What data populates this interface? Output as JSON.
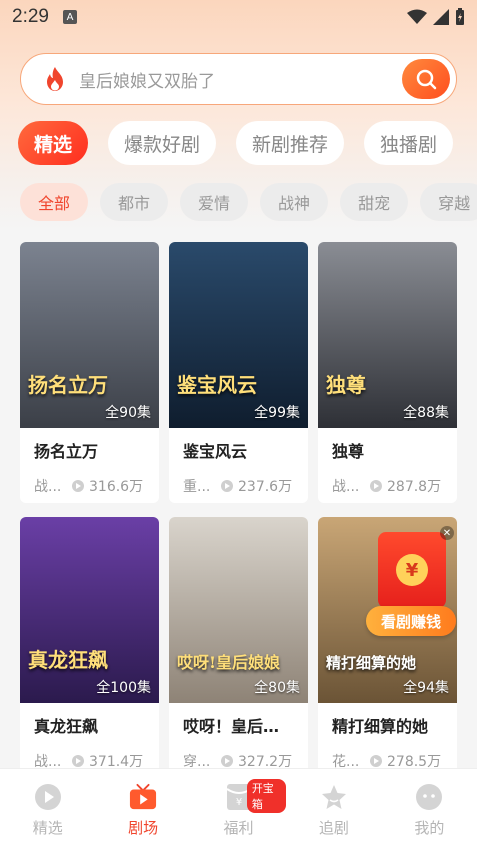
{
  "status_bar": {
    "time": "2:29",
    "notification_icon": "A"
  },
  "search": {
    "placeholder": "皇后娘娘又双胎了"
  },
  "main_tabs": [
    {
      "label": "精选",
      "active": true
    },
    {
      "label": "爆款好剧",
      "active": false
    },
    {
      "label": "新剧推荐",
      "active": false
    },
    {
      "label": "独播剧",
      "active": false
    }
  ],
  "sub_tabs": [
    {
      "label": "全部",
      "active": true
    },
    {
      "label": "都市",
      "active": false
    },
    {
      "label": "爱情",
      "active": false
    },
    {
      "label": "战神",
      "active": false
    },
    {
      "label": "甜宠",
      "active": false
    },
    {
      "label": "穿越",
      "active": false
    }
  ],
  "dramas": [
    {
      "title": "扬名立万",
      "episodes": "全90集",
      "genre": "战...",
      "views": "316.6万",
      "poster_text": "扬名立万",
      "poster_sub": "YANG  MIN  WAN",
      "colors": [
        "#7c8390",
        "#3b3f47"
      ]
    },
    {
      "title": "鉴宝风云",
      "episodes": "全99集",
      "genre": "重...",
      "views": "237.6万",
      "poster_text": "鉴宝风云",
      "poster_sub": "",
      "colors": [
        "#2a4a6b",
        "#0f1d2e"
      ]
    },
    {
      "title": "独尊",
      "episodes": "全88集",
      "genre": "战...",
      "views": "287.8万",
      "poster_text": "独尊",
      "poster_sub": "",
      "colors": [
        "#8a8d94",
        "#2e3036"
      ]
    },
    {
      "title": "真龙狂飙",
      "episodes": "全100集",
      "genre": "战...",
      "views": "371.4万",
      "poster_text": "真龙狂飙",
      "poster_sub": "ZHEN LONG KUANG BIAO",
      "colors": [
        "#6a3fa6",
        "#2b1a4d"
      ]
    },
    {
      "title": "哎呀！皇后娘...",
      "episodes": "全80集",
      "genre": "穿...",
      "views": "327.2万",
      "poster_text": "哎呀!皇后娘娘",
      "poster_sub": "",
      "colors": [
        "#d9d4cc",
        "#8e8376"
      ]
    },
    {
      "title": "精打细算的她",
      "episodes": "全94集",
      "genre": "花...",
      "views": "278.5万",
      "poster_text": "精打细算的她",
      "poster_sub": "",
      "colors": [
        "#c9a676",
        "#6b5436"
      ]
    }
  ],
  "promo": {
    "label": "看剧赚钱",
    "coin": "¥"
  },
  "bottom_nav": [
    {
      "label": "精选",
      "icon": "play-circle-icon",
      "active": false
    },
    {
      "label": "剧场",
      "icon": "tv-icon",
      "active": true
    },
    {
      "label": "福利",
      "icon": "red-envelope-icon",
      "active": false,
      "badge": "开宝箱"
    },
    {
      "label": "追剧",
      "icon": "star-icon",
      "active": false
    },
    {
      "label": "我的",
      "icon": "profile-icon",
      "active": false
    }
  ],
  "colors": {
    "accent": "#f0452d",
    "search_border": "#f7a77a"
  }
}
